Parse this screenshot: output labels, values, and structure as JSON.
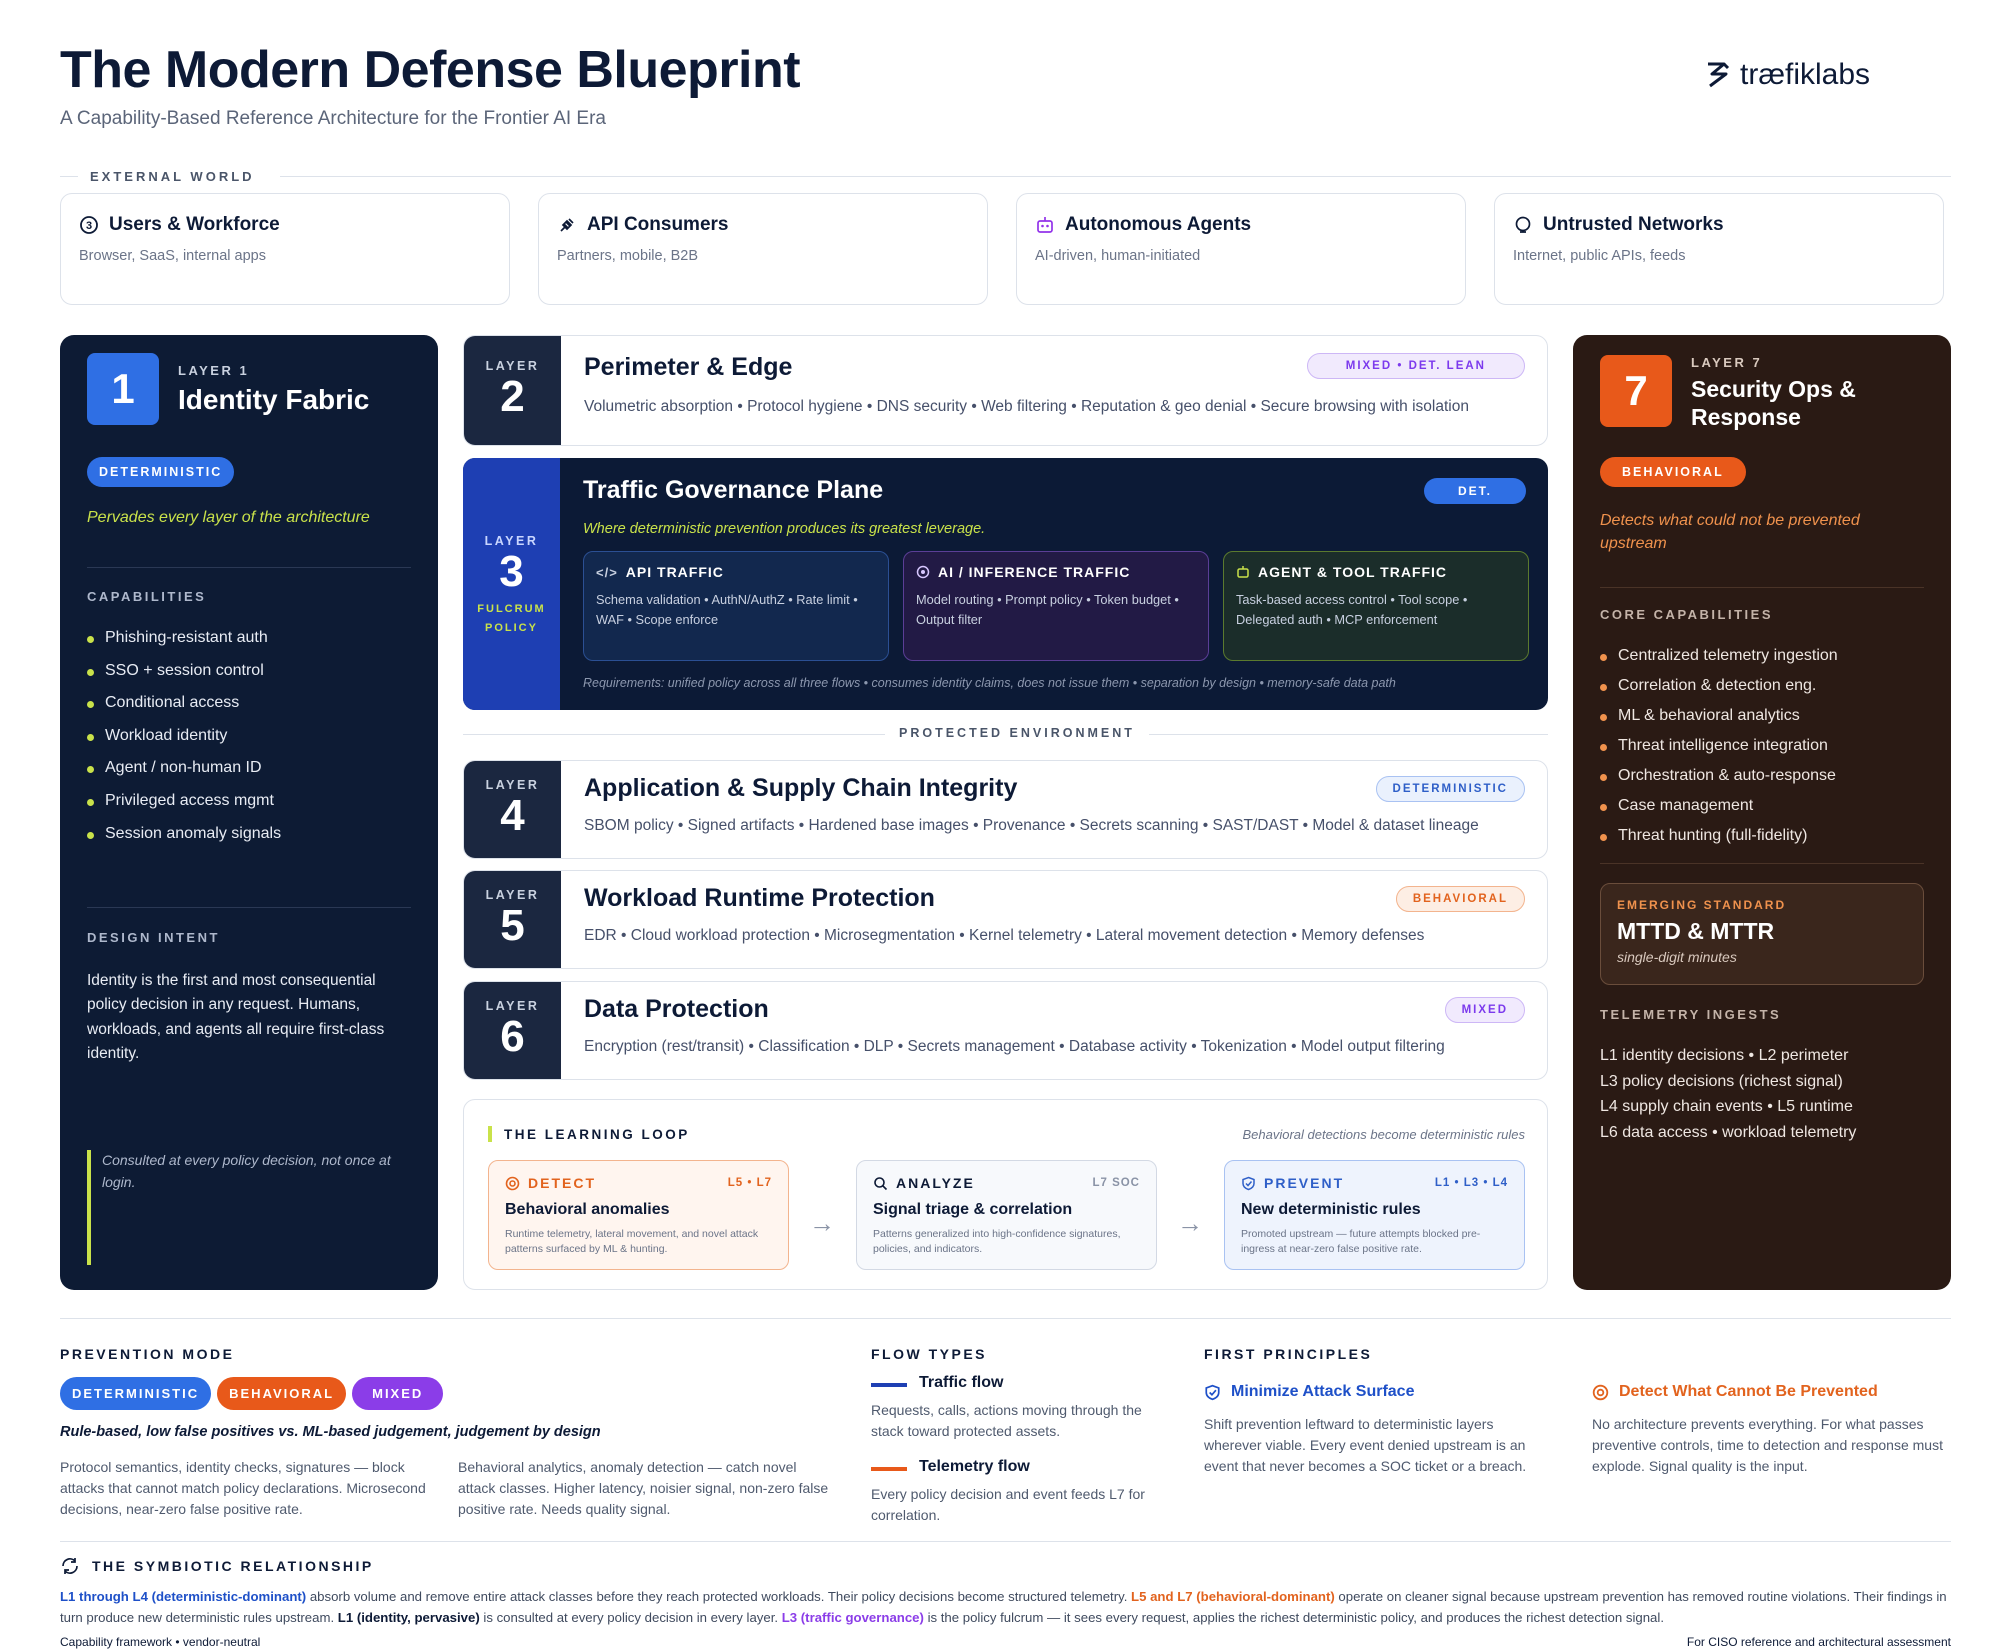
{
  "header": {
    "title": "The Modern Defense Blueprint",
    "subtitle": "A Capability-Based Reference Architecture for the Frontier AI Era",
    "logo": "træfiklabs"
  },
  "external": {
    "label": "EXTERNAL WORLD",
    "cards": [
      {
        "title": "Users & Workforce",
        "sub": "Browser, SaaS, internal apps",
        "icon": "users-icon"
      },
      {
        "title": "API Consumers",
        "sub": "Partners, mobile, B2B",
        "icon": "plug-icon"
      },
      {
        "title": "Autonomous Agents",
        "sub": "AI-driven, human-initiated",
        "icon": "robot-icon"
      },
      {
        "title": "Untrusted Networks",
        "sub": "Internet, public APIs, feeds",
        "icon": "globe-icon"
      }
    ]
  },
  "layer1": {
    "num": "1",
    "label": "LAYER 1",
    "title": "Identity Fabric",
    "badge": "DETERMINISTIC",
    "tagline": "Pervades every layer of the architecture",
    "cap_label": "CAPABILITIES",
    "capabilities": [
      "Phishing-resistant auth",
      "SSO + session control",
      "Conditional access",
      "Workload identity",
      "Agent / non-human ID",
      "Privileged access mgmt",
      "Session anomaly signals"
    ],
    "intent_label": "DESIGN INTENT",
    "intent": "Identity is the first and most consequential policy decision in any request. Humans, workloads, and agents all require first-class identity.",
    "note": "Consulted at every policy decision, not once at login."
  },
  "layer2": {
    "label": "LAYER",
    "num": "2",
    "title": "Perimeter & Edge",
    "badge": "MIXED • DET. LEAN",
    "desc": "Volumetric absorption • Protocol hygiene • DNS security • Web filtering • Reputation & geo denial • Secure browsing with isolation"
  },
  "layer3": {
    "label": "LAYER",
    "num": "3",
    "sub": "FULCRUM",
    "sub2": "POLICY",
    "title": "Traffic Governance Plane",
    "badge": "DET.",
    "tagline": "Where deterministic prevention produces its greatest leverage.",
    "flows": [
      {
        "title": "API TRAFFIC",
        "body": "Schema validation • AuthN/AuthZ • Rate limit • WAF • Scope enforce"
      },
      {
        "title": "AI / INFERENCE TRAFFIC",
        "body": "Model routing • Prompt policy • Token budget • Output filter"
      },
      {
        "title": "AGENT & TOOL TRAFFIC",
        "body": "Task-based access control • Tool scope • Delegated auth • MCP enforcement"
      }
    ],
    "requirements": "Requirements: unified policy across all three flows • consumes identity claims, does not issue them • separation by design • memory-safe data path"
  },
  "protected_label": "PROTECTED ENVIRONMENT",
  "layer4": {
    "label": "LAYER",
    "num": "4",
    "title": "Application & Supply Chain Integrity",
    "badge": "DETERMINISTIC",
    "desc": "SBOM policy • Signed artifacts • Hardened base images • Provenance • Secrets scanning • SAST/DAST • Model & dataset lineage"
  },
  "layer5": {
    "label": "LAYER",
    "num": "5",
    "title": "Workload Runtime Protection",
    "badge": "BEHAVIORAL",
    "desc": "EDR • Cloud workload protection • Microsegmentation • Kernel telemetry • Lateral movement detection • Memory defenses"
  },
  "layer6": {
    "label": "LAYER",
    "num": "6",
    "title": "Data Protection",
    "badge": "MIXED",
    "desc": "Encryption (rest/transit) • Classification • DLP • Secrets management • Database activity • Tokenization • Model output filtering"
  },
  "loop": {
    "label": "THE LEARNING LOOP",
    "note": "Behavioral detections become deterministic rules",
    "cards": [
      {
        "name": "DETECT",
        "range": "L5 • L7",
        "title": "Behavioral anomalies",
        "desc": "Runtime telemetry, lateral movement, and novel attack patterns surfaced by ML & hunting."
      },
      {
        "name": "ANALYZE",
        "range": "L7 SOC",
        "title": "Signal triage & correlation",
        "desc": "Patterns generalized into high-confidence signatures, policies, and indicators."
      },
      {
        "name": "PREVENT",
        "range": "L1 • L3 • L4",
        "title": "New deterministic rules",
        "desc": "Promoted upstream — future attempts blocked pre-ingress at near-zero false positive rate."
      }
    ]
  },
  "layer7": {
    "num": "7",
    "label": "LAYER 7",
    "title1": "Security Ops &",
    "title2": "Response",
    "badge": "BEHAVIORAL",
    "tagline": "Detects what could not be prevented upstream",
    "cap_label": "CORE CAPABILITIES",
    "capabilities": [
      "Centralized telemetry ingestion",
      "Correlation & detection eng.",
      "ML & behavioral analytics",
      "Threat intelligence integration",
      "Orchestration & auto-response",
      "Case management",
      "Threat hunting (full-fidelity)"
    ],
    "emerging_label": "EMERGING STANDARD",
    "emerging_title": "MTTD & MTTR",
    "emerging_sub": "single-digit minutes",
    "ingest_label": "TELEMETRY INGESTS",
    "ingests": [
      "L1 identity decisions • L2 perimeter",
      "L3 policy decisions (richest signal)",
      "L4 supply chain events • L5 runtime",
      "L6 data access • workload telemetry"
    ]
  },
  "bottom": {
    "mode_label": "PREVENTION MODE",
    "modes": [
      "DETERMINISTIC",
      "BEHAVIORAL",
      "MIXED"
    ],
    "mode_caption": "Rule-based, low false positives vs. ML-based judgement, judgement by design",
    "det_text": "Protocol semantics, identity checks, signatures — block attacks that cannot match policy declarations. Microsecond decisions, near-zero false positive rate.",
    "beh_text": "Behavioral analytics, anomaly detection — catch novel attack classes. Higher latency, noisier signal, non-zero false positive rate. Needs quality signal.",
    "flow_label": "FLOW TYPES",
    "traffic_title": "Traffic flow",
    "traffic_text": "Requests, calls, actions moving through the stack toward protected assets.",
    "telemetry_title": "Telemetry flow",
    "telemetry_text": "Every policy decision and event feeds L7 for correlation.",
    "principles_label": "FIRST PRINCIPLES",
    "p1_title": "Minimize Attack Surface",
    "p1_text": "Shift prevention leftward to deterministic layers wherever viable. Every event denied upstream is an event that never becomes a SOC ticket or a breach.",
    "p2_title": "Detect What Cannot Be Prevented",
    "p2_text": "No architecture prevents everything. For what passes preventive controls, time to detection and response must explode. Signal quality is the input.",
    "sym_label": "THE SYMBIOTIC RELATIONSHIP",
    "sym": {
      "a1": "L1 through L4 (deterministic-dominant)",
      "t1": " absorb volume and remove entire attack classes before they reach protected workloads. Their policy decisions become structured telemetry. ",
      "a2": "L5 and L7 (behavioral-dominant)",
      "t2": " operate on cleaner signal because upstream prevention has removed routine violations. Their findings in turn produce new deterministic rules upstream. ",
      "a3": "L1 (identity, pervasive)",
      "t3": " is consulted at every policy decision in every layer. ",
      "a4": "L3 (traffic governance)",
      "t4": " is the policy fulcrum — it sees every request, applies the richest deterministic policy, and produces the richest detection signal."
    },
    "foot_left": "Capability framework • vendor-neutral",
    "foot_right": "For CISO reference and architectural assessment"
  }
}
